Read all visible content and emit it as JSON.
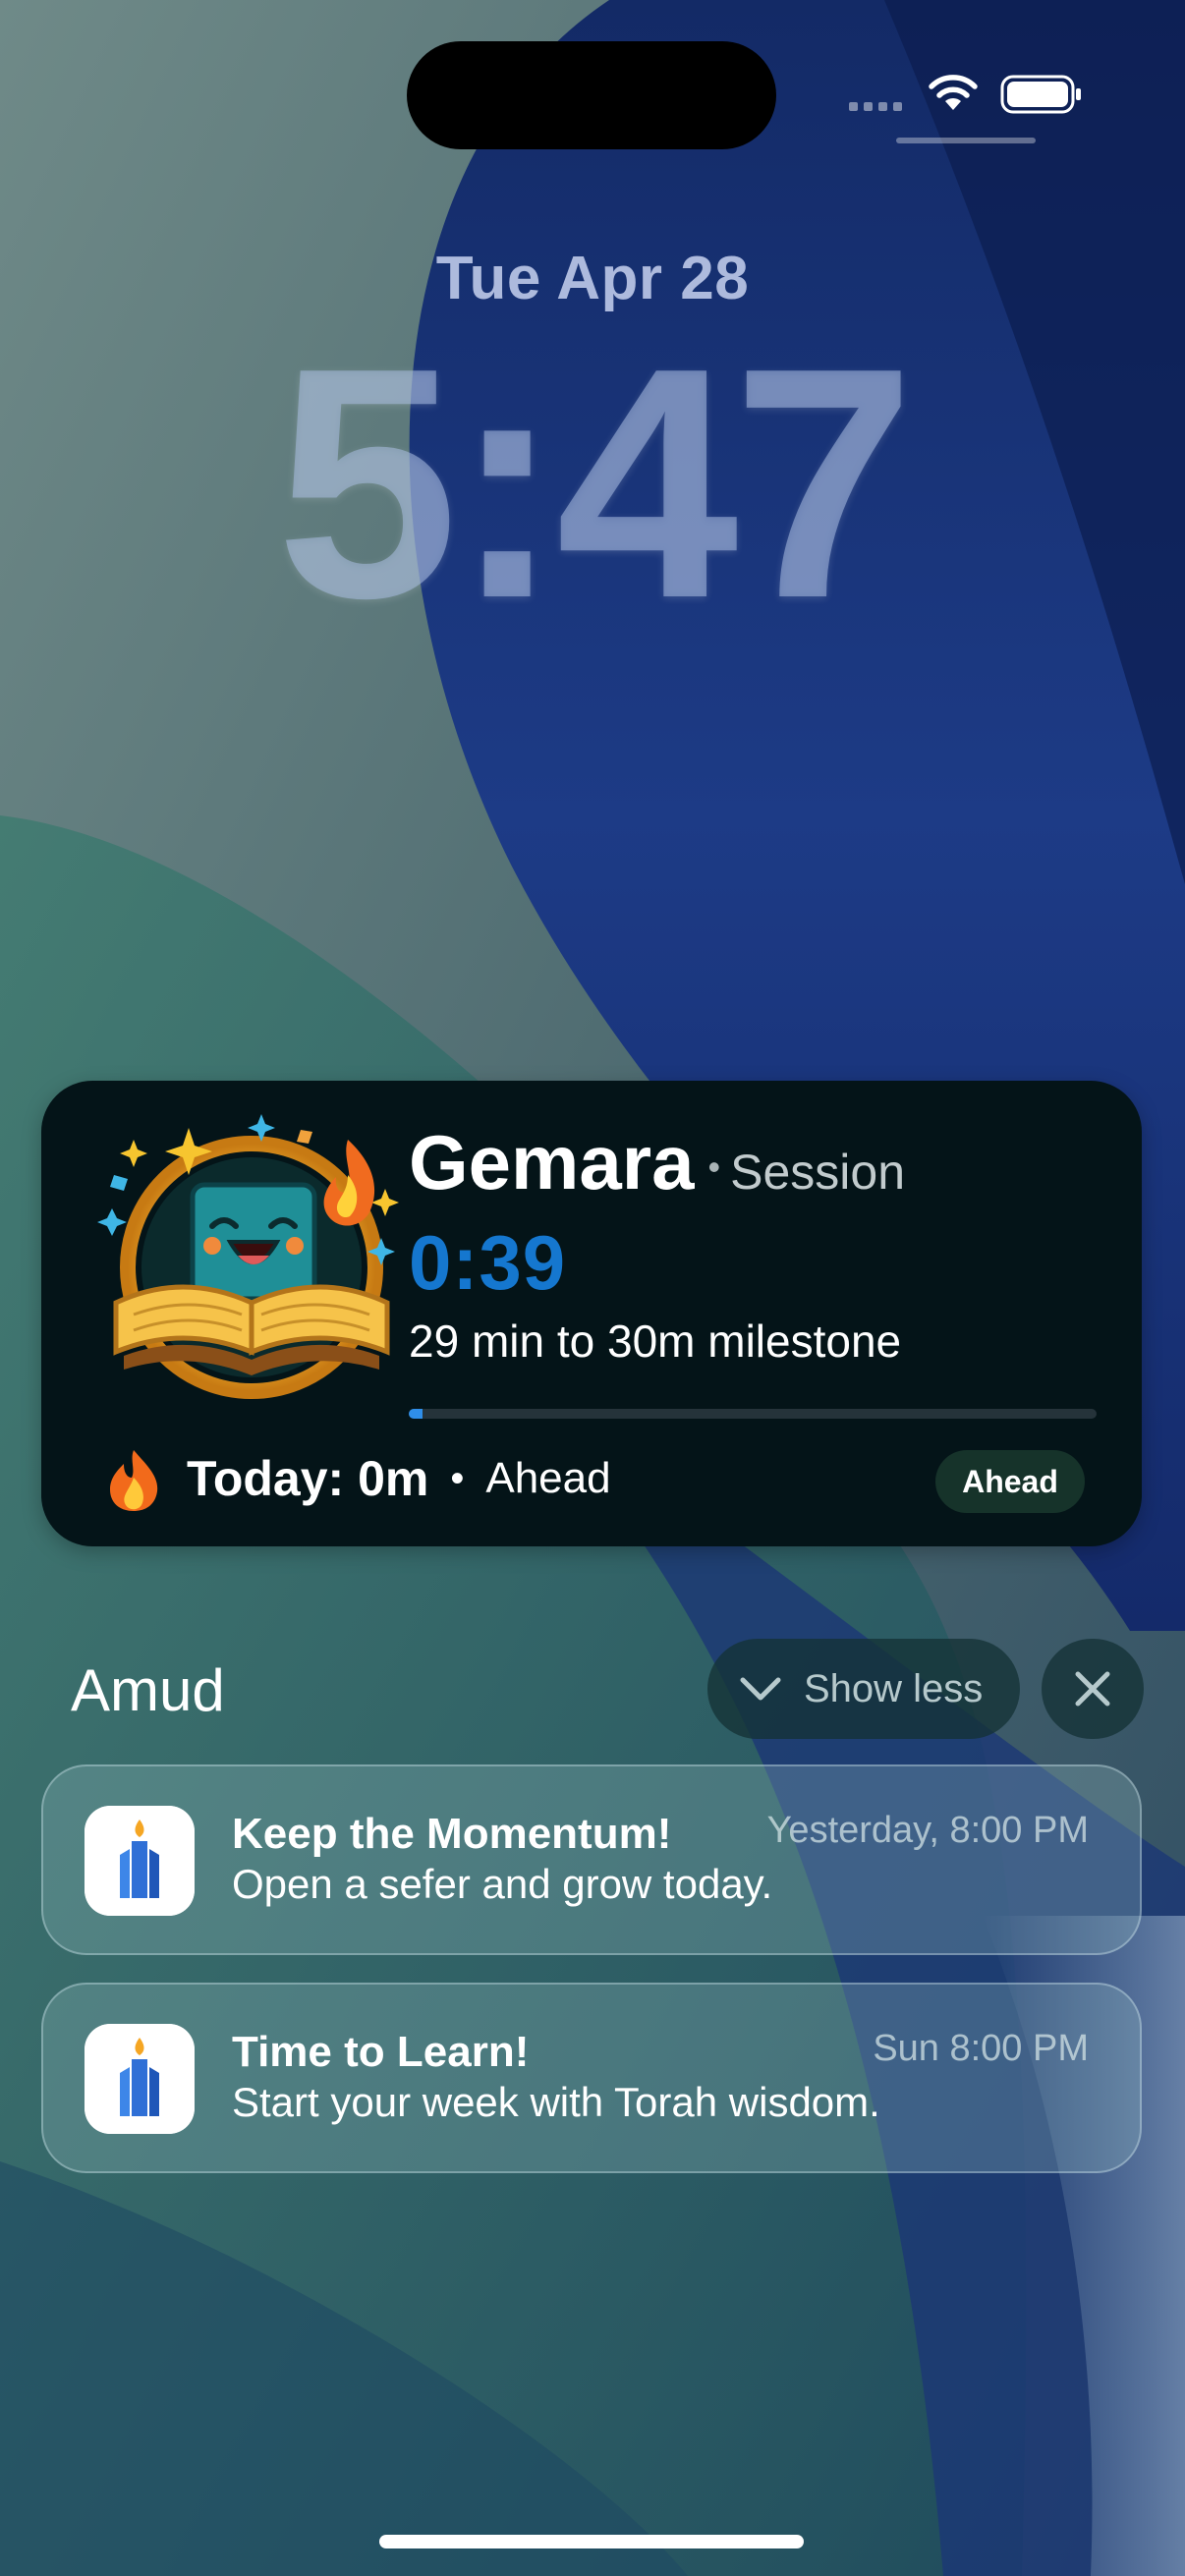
{
  "lock_screen": {
    "date": "Tue Apr 28",
    "time": "5:47"
  },
  "status_bar": {
    "icons": [
      "signal-dots-icon",
      "wifi-icon",
      "battery-icon"
    ]
  },
  "live_activity": {
    "title": "Gemara",
    "separator": "•",
    "kind": "Session",
    "timer": "0:39",
    "subtitle": "29 min to 30m milestone",
    "progress": 0.02,
    "today": "Today: 0m",
    "dot": "•",
    "status": "Ahead",
    "badge": "Ahead",
    "icons": [
      "gemara-mascot-icon",
      "fire-icon"
    ],
    "timer_color": "#1577cf"
  },
  "notification_group": {
    "app_name": "Amud",
    "show_less_label": "Show less",
    "notifications": [
      {
        "title": "Keep the Momentum!",
        "body": "Open a sefer and grow today.",
        "time": "Yesterday, 8:00 PM"
      },
      {
        "title": "Time to Learn!",
        "body": "Start your week with Torah wisdom.",
        "time": "Sun 8:00 PM"
      }
    ]
  },
  "colors": {
    "activity_background": "#041418",
    "badge_background": "#16332a"
  }
}
